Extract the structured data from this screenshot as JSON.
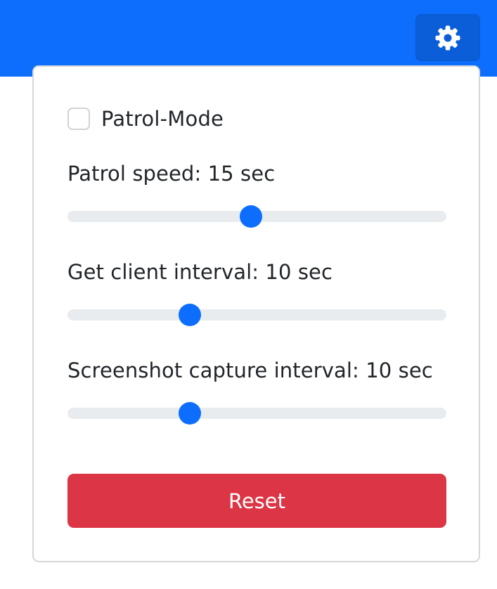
{
  "colors": {
    "primary": "#0d6efd",
    "danger": "#dc3545"
  },
  "header": {
    "settings_icon": "gear-icon"
  },
  "settings": {
    "patrol_mode": {
      "label": "Patrol-Mode",
      "checked": false
    },
    "sliders": [
      {
        "label": "Patrol speed: 15 sec",
        "fraction": 0.485
      },
      {
        "label": "Get client interval: 10 sec",
        "fraction": 0.323
      },
      {
        "label": "Screenshot capture interval: 10 sec",
        "fraction": 0.323
      }
    ],
    "reset_label": "Reset"
  }
}
